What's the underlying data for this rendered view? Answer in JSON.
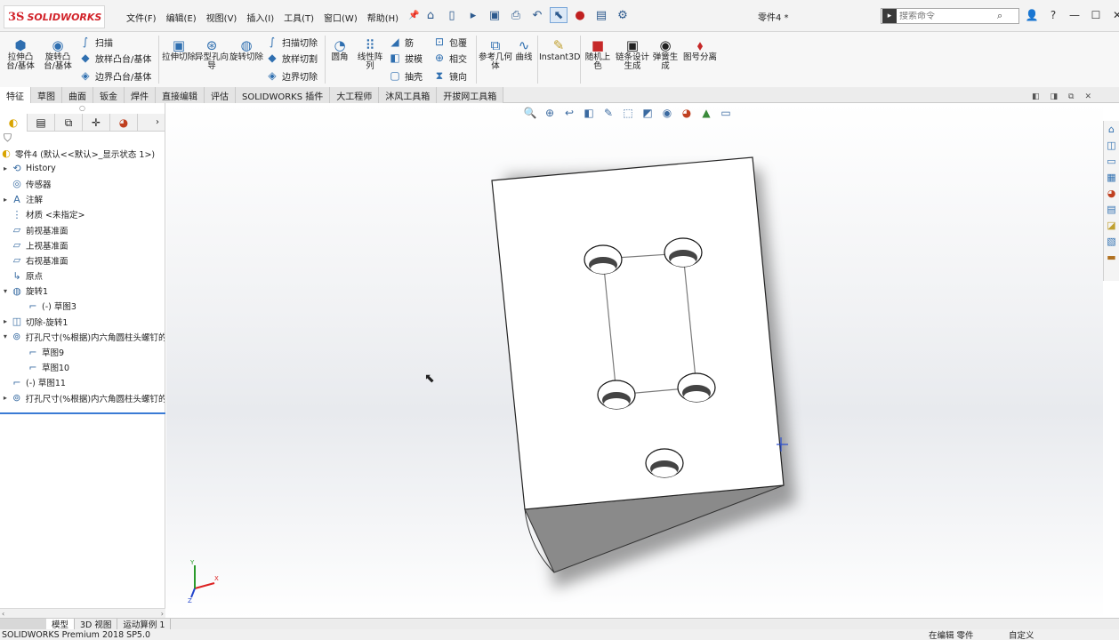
{
  "app": {
    "logo_mark": "3S",
    "logo_text": "SOLIDWORKS",
    "document_title": "零件4 *"
  },
  "menus": [
    "文件(F)",
    "编辑(E)",
    "视图(V)",
    "插入(I)",
    "工具(T)",
    "窗口(W)",
    "帮助(H)"
  ],
  "search": {
    "placeholder": "搜索命令"
  },
  "ribbon": {
    "extrude_boss": "拉伸凸台/基体",
    "revolve_boss": "旋转凸台/基体",
    "sweep_boss": "扫描",
    "loft_boss": "放样凸台/基体",
    "boundary_boss": "边界凸台/基体",
    "extrude_cut": "拉伸切除",
    "hole_wizard": "异型孔向导",
    "revolve_cut": "旋转切除",
    "sweep_cut": "扫描切除",
    "loft_cut": "放样切割",
    "boundary_cut": "边界切除",
    "fillet": "圆角",
    "linear_pattern": "线性阵列",
    "rib": "筋",
    "draft": "拔模",
    "shell": "抽壳",
    "wrap": "包覆",
    "intersect": "相交",
    "mirror": "镜向",
    "ref_geometry": "参考几何体",
    "curves": "曲线",
    "instant3d": "Instant3D",
    "random_color": "随机上色",
    "chain_design": "链条设计生成",
    "spring": "弹簧生成",
    "layer_split": "图号分离"
  },
  "command_tabs": [
    "特征",
    "草图",
    "曲面",
    "钣金",
    "焊件",
    "直接编辑",
    "评估",
    "SOLIDWORKS 插件",
    "大工程师",
    "沐风工具箱",
    "开拔网工具箱"
  ],
  "feature_tree": {
    "root": "零件4 (默认<<默认>_显示状态 1>)",
    "items": [
      {
        "label": "History",
        "icon": "history-icon",
        "arrow": "▸",
        "indent": 0
      },
      {
        "label": "传感器",
        "icon": "sensor-icon",
        "arrow": "",
        "indent": 0
      },
      {
        "label": "注解",
        "icon": "annotation-icon",
        "arrow": "▸",
        "indent": 0
      },
      {
        "label": "材质 <未指定>",
        "icon": "material-icon",
        "arrow": "",
        "indent": 0
      },
      {
        "label": "前视基准面",
        "icon": "plane-icon",
        "arrow": "",
        "indent": 0
      },
      {
        "label": "上视基准面",
        "icon": "plane-icon",
        "arrow": "",
        "indent": 0
      },
      {
        "label": "右视基准面",
        "icon": "plane-icon",
        "arrow": "",
        "indent": 0
      },
      {
        "label": "原点",
        "icon": "origin-icon",
        "arrow": "",
        "indent": 0
      },
      {
        "label": "旋转1",
        "icon": "revolve-icon",
        "arrow": "▾",
        "indent": 0
      },
      {
        "label": "(-) 草图3",
        "icon": "sketch-icon",
        "arrow": "",
        "indent": 1
      },
      {
        "label": "切除-旋转1",
        "icon": "cut-revolve-icon",
        "arrow": "▸",
        "indent": 0
      },
      {
        "label": "打孔尺寸(%根据)内六角圆柱头螺钉的",
        "icon": "hole-icon",
        "arrow": "▾",
        "indent": 0
      },
      {
        "label": "草图9",
        "icon": "sketch-icon",
        "arrow": "",
        "indent": 1
      },
      {
        "label": "草图10",
        "icon": "sketch-icon",
        "arrow": "",
        "indent": 1
      },
      {
        "label": "(-) 草图11",
        "icon": "sketch-icon",
        "arrow": "",
        "indent": 0
      },
      {
        "label": "打孔尺寸(%根据)内六角圆柱头螺钉的",
        "icon": "hole-icon",
        "arrow": "▸",
        "indent": 0
      }
    ]
  },
  "bottom_tabs": [
    "模型",
    "3D 视图",
    "运动算例 1"
  ],
  "status": {
    "product": "SOLIDWORKS Premium 2018 SP5.0",
    "mode": "在编辑 零件",
    "units": "自定义"
  },
  "colors": {
    "accent": "#2f6fb0",
    "brand_red": "#d2232a",
    "face_white": "#ffffff",
    "face_gray": "#8a8a8a"
  }
}
